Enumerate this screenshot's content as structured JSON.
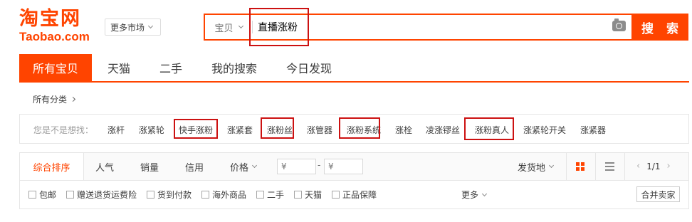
{
  "header": {
    "logo_cn": "淘宝网",
    "logo_en": "Taobao.com",
    "market_label": "更多市场",
    "search_type": "宝贝",
    "search_value": "直播涨粉",
    "search_button": "搜 索"
  },
  "tabs": [
    {
      "label": "所有宝贝",
      "active": true
    },
    {
      "label": "天猫"
    },
    {
      "label": "二手"
    },
    {
      "label": "我的搜索"
    },
    {
      "label": "今日发现"
    }
  ],
  "category": {
    "label": "所有分类"
  },
  "suggestions": {
    "title": "您是不是想找：",
    "items": [
      "涨杆",
      "涨紧轮",
      "快手涨粉",
      "涨紧套",
      "涨粉丝",
      "涨管器",
      "涨粉系统",
      "涨栓",
      "凌涨镠丝",
      "涨粉真人",
      "涨紧轮开关",
      "涨紧器"
    ],
    "highlighted": [
      "快手涨粉",
      "涨粉丝",
      "涨粉系统",
      "涨粉真人"
    ]
  },
  "sort_bar": {
    "tabs": [
      "综合排序",
      "人气",
      "销量",
      "信用",
      "价格"
    ],
    "price_min_placeholder": "¥",
    "price_max_placeholder": "¥",
    "price_separator": "-",
    "location_label": "发货地",
    "page_indicator": "1/1"
  },
  "filters": {
    "items": [
      "包邮",
      "赠送退货运费险",
      "货到付款",
      "海外商品",
      "二手",
      "天猫",
      "正品保障"
    ],
    "more_label": "更多",
    "merge_sellers": "合并卖家"
  },
  "colors": {
    "accent": "#ff4400",
    "annotation_box": "#cc1111"
  }
}
